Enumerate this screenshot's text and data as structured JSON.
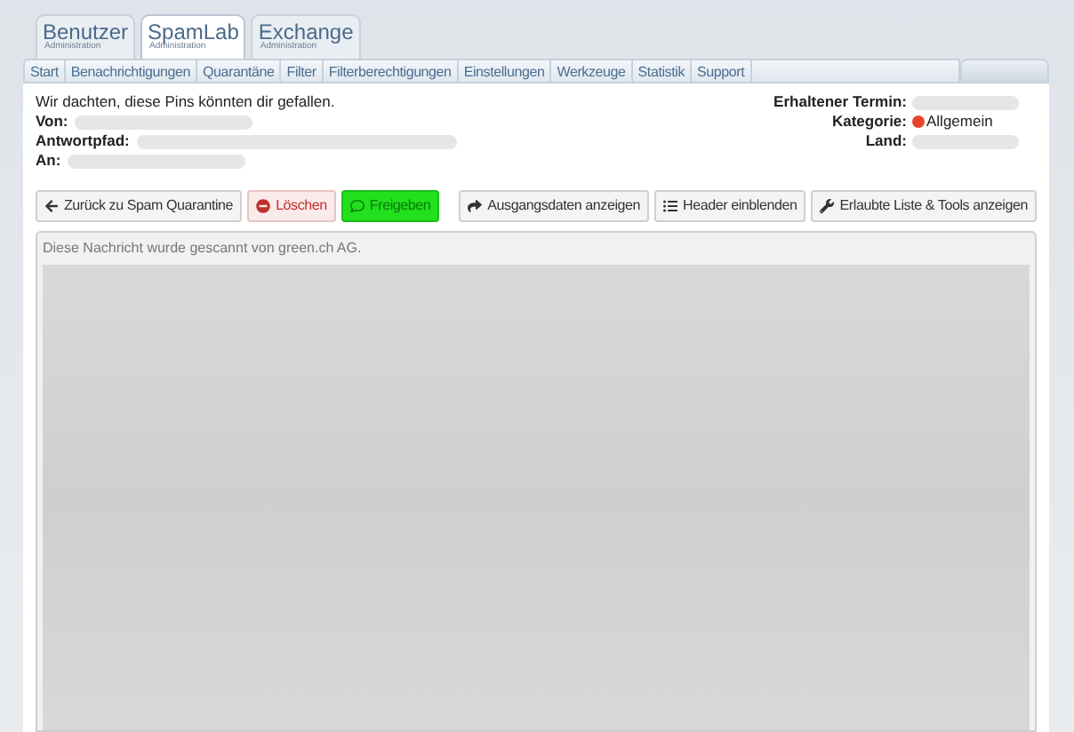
{
  "top_tabs": [
    {
      "label": "Benutzer",
      "sublabel": "Administration",
      "selected": false
    },
    {
      "label": "SpamLab",
      "sublabel": "Administration",
      "selected": true
    },
    {
      "label": "Exchange",
      "sublabel": "Administration",
      "selected": false
    }
  ],
  "nav": [
    "Start",
    "Benachrichtigungen",
    "Quarantäne",
    "Filter",
    "Filterberechtigungen",
    "Einstellungen",
    "Werkzeuge",
    "Statistik",
    "Support"
  ],
  "message": {
    "subject": "Wir dachten, diese Pins könnten dir gefallen.",
    "left_fields": [
      {
        "label": "Von:"
      },
      {
        "label": "Antwortpfad:"
      },
      {
        "label": "An:"
      }
    ],
    "right_fields": [
      {
        "kind": "redacted",
        "label": "Erhaltener Termin:"
      },
      {
        "kind": "category",
        "label": "Kategorie:",
        "value": "Allgemein",
        "color": "#e8432c"
      },
      {
        "kind": "redacted",
        "label": "Land:"
      }
    ]
  },
  "actions_left": [
    {
      "kind": "back",
      "label": "Zurück zu Spam Quarantine"
    },
    {
      "kind": "delete",
      "label": "Löschen"
    },
    {
      "kind": "release",
      "label": "Freigeben"
    }
  ],
  "actions_right": [
    {
      "kind": "share",
      "label": "Ausgangsdaten anzeigen"
    },
    {
      "kind": "list",
      "label": "Header einblenden"
    },
    {
      "kind": "wrench",
      "label": "Erlaubte Liste & Tools anzeigen"
    }
  ],
  "body": {
    "notice": "Diese Nachricht wurde gescannt von green.ch AG."
  }
}
